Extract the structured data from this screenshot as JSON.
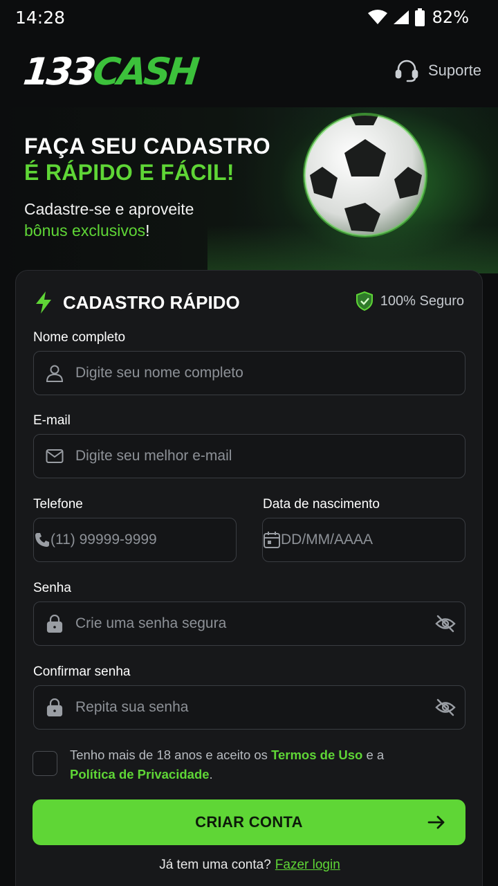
{
  "status_bar": {
    "time": "14:28",
    "battery": "82%"
  },
  "header": {
    "logo_number": "133",
    "logo_word": "CASH",
    "support_label": "Suporte"
  },
  "hero": {
    "title_line1": "FAÇA SEU CADASTRO",
    "title_line2": "É RÁPIDO E FÁCIL!",
    "subtitle_line1": "Cadastre-se e aproveite",
    "subtitle_highlight": "bônus exclusivos",
    "subtitle_end": "!"
  },
  "form": {
    "title": "CADASTRO RÁPIDO",
    "secure_label": "100% Seguro",
    "fields": {
      "name": {
        "label": "Nome completo",
        "placeholder": "Digite seu nome completo",
        "value": ""
      },
      "email": {
        "label": "E-mail",
        "placeholder": "Digite seu melhor e-mail",
        "value": ""
      },
      "phone": {
        "label": "Telefone",
        "placeholder": "(11) 99999-9999",
        "value": ""
      },
      "birth": {
        "label": "Data de nascimento",
        "placeholder": "DD/MM/AAAA",
        "value": ""
      },
      "password": {
        "label": "Senha",
        "placeholder": "Crie uma senha segura",
        "value": ""
      },
      "confirm": {
        "label": "Confirmar senha",
        "placeholder": "Repita sua senha",
        "value": ""
      }
    },
    "terms": {
      "prefix": "Tenho mais de 18 anos e aceito os ",
      "terms_link": "Termos de Uso",
      "middle": " e a",
      "privacy_link": "Política de Privacidade",
      "suffix": ".",
      "checked": false
    },
    "submit_label": "CRIAR CONTA",
    "login_prompt": "Já tem uma conta?",
    "login_link": "Fazer login"
  },
  "colors": {
    "accent": "#5fd636",
    "background": "#0c0d0e",
    "card": "#17181a"
  },
  "icons": {
    "support": "headset-icon",
    "bolt": "lightning-icon",
    "shield": "shield-check-icon",
    "user": "user-icon",
    "mail": "mail-icon",
    "phone": "phone-icon",
    "calendar": "calendar-icon",
    "lock": "lock-icon",
    "eye": "eye-off-icon",
    "arrow": "arrow-right-icon"
  }
}
